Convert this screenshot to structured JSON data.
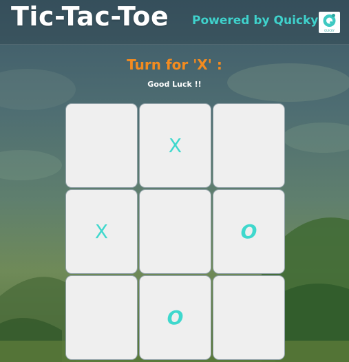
{
  "header": {
    "title": "Tic-Tac-Toe",
    "powered_by": "Powered by Quicky",
    "logo_text": "QUICKY"
  },
  "status": {
    "turn_text": "Turn for 'X' :",
    "message": "Good Luck !!"
  },
  "board": {
    "cells": [
      "",
      "X",
      "",
      "X",
      "",
      "O",
      "",
      "O",
      ""
    ]
  },
  "colors": {
    "accent": "#3fd2cc",
    "turn": "#f38b1f",
    "cell_bg": "#efefef"
  }
}
